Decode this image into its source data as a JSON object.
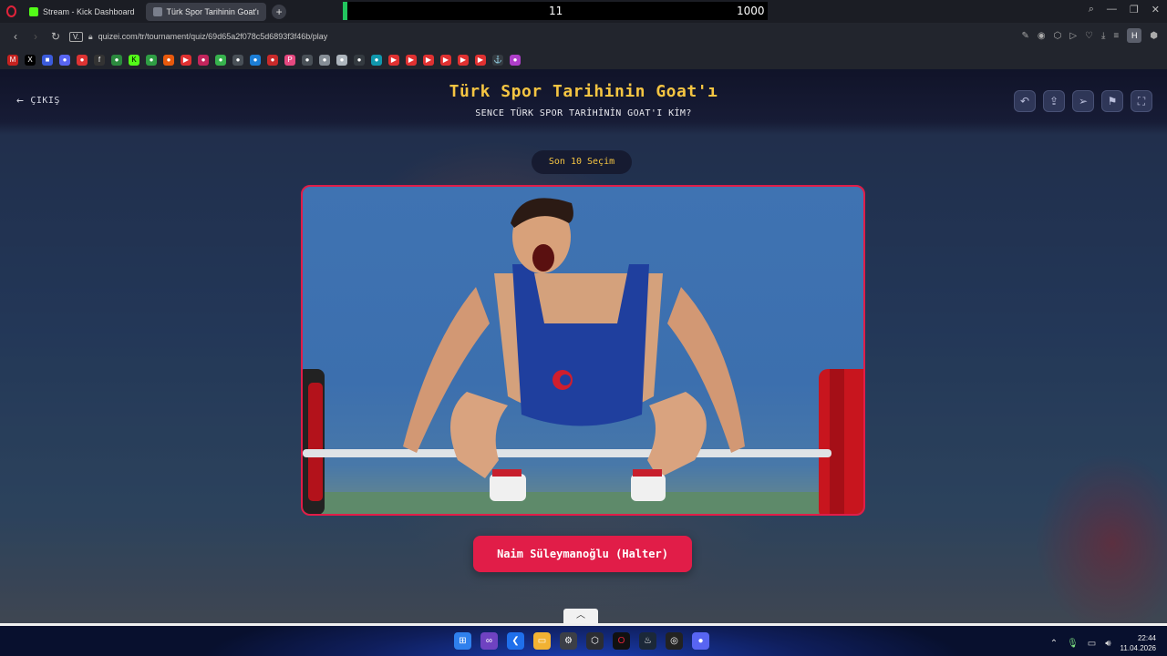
{
  "browser": {
    "tabs": [
      {
        "label": "Stream - Kick Dashboard",
        "active": false
      },
      {
        "label": "Türk Spor Tarihinin Goat'ı",
        "active": true
      }
    ],
    "new_tab_label": "+",
    "counter": {
      "left": "11",
      "right": "1000"
    },
    "url": "quizei.com/tr/tournament/quiz/69d65a2f078c5d6893f3f46b/play",
    "site_badge": "V.",
    "profile_initial": "H"
  },
  "page": {
    "exit_label": "ÇIKIŞ",
    "title": "Türk Spor Tarihinin Goat'ı",
    "subtitle": "SENCE TÜRK SPOR TARİHİNİN GOAT'I KİM?",
    "round_badge": "Son 10 Seçim",
    "choice_name": "Naim Süleymanoğlu (Halter)",
    "tool_icons": [
      "undo-icon",
      "share-icon",
      "send-icon",
      "flag-icon",
      "fullscreen-icon"
    ]
  },
  "taskbar": {
    "time": "22:44",
    "date": "11.04.2026"
  },
  "colors": {
    "accent_red": "#e11d48",
    "title_gold": "#f5c542",
    "counter_green": "#22c55e"
  }
}
